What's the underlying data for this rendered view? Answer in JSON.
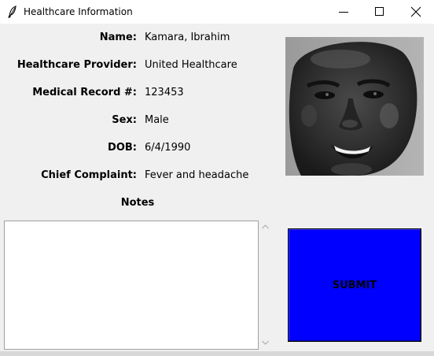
{
  "window": {
    "title": "Healthcare Information"
  },
  "fields": [
    {
      "label": "Name:",
      "value": "Kamara, Ibrahim"
    },
    {
      "label": "Healthcare Provider:",
      "value": "United Healthcare"
    },
    {
      "label": "Medical Record #:",
      "value": "123453"
    },
    {
      "label": "Sex:",
      "value": "Male"
    },
    {
      "label": "DOB:",
      "value": "6/4/1990"
    },
    {
      "label": "Chief Complaint:",
      "value": "Fever and headache"
    }
  ],
  "notes": {
    "label": "Notes",
    "value": ""
  },
  "submit": {
    "label": "SUBMIT",
    "color": "#0000ff"
  },
  "icons": {
    "app": "feather-icon",
    "minimize": "minimize-icon",
    "maximize": "maximize-icon",
    "close": "close-icon",
    "scroll_up": "chevron-up-icon",
    "scroll_down": "chevron-down-icon"
  }
}
